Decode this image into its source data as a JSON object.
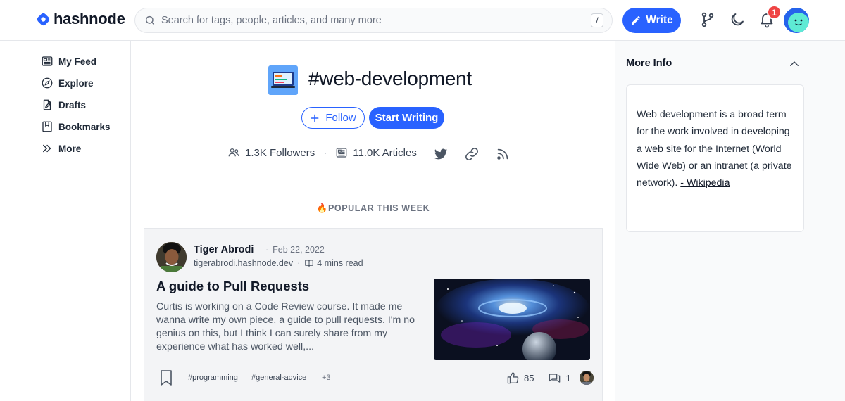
{
  "header": {
    "logo_text": "hashnode",
    "search_placeholder": "Search for tags, people, articles, and many more",
    "search_shortcut": "/",
    "write_label": "Write",
    "notification_count": "1",
    "colors": {
      "accent": "#2962ff",
      "badge": "#ef4444"
    }
  },
  "sidebar": {
    "items": [
      {
        "label": "My Feed",
        "icon": "feed-icon"
      },
      {
        "label": "Explore",
        "icon": "compass-icon"
      },
      {
        "label": "Drafts",
        "icon": "drafts-icon"
      },
      {
        "label": "Bookmarks",
        "icon": "bookmark-icon"
      },
      {
        "label": "More",
        "icon": "double-chevron-right-icon"
      }
    ]
  },
  "tag": {
    "title": "#web-development",
    "follow_label": "Follow",
    "start_writing_label": "Start Writing",
    "followers": "1.3K Followers",
    "articles": "11.0K Articles"
  },
  "popular": {
    "heading": "POPULAR THIS WEEK"
  },
  "post": {
    "author": "Tiger Abrodi",
    "date": "Feb 22, 2022",
    "blog": "tigerabrodi.hashnode.dev",
    "read_time": "4 mins read",
    "title": "A guide to Pull Requests",
    "excerpt": "Curtis is working on a Code Review course. It made me wanna write my own piece, a guide to pull requests. I'm no genius on this, but I think I can surely share from my experience what has worked well,...",
    "tags": [
      "#programming",
      "#general-advice",
      "+3"
    ],
    "likes": "85",
    "comments": "1"
  },
  "more_info": {
    "title": "More Info",
    "description": "Web development is a broad term for the work involved in developing a web site for the Internet (World Wide Web) or an intranet (a private network). ",
    "link_label": "- Wikipedia"
  }
}
